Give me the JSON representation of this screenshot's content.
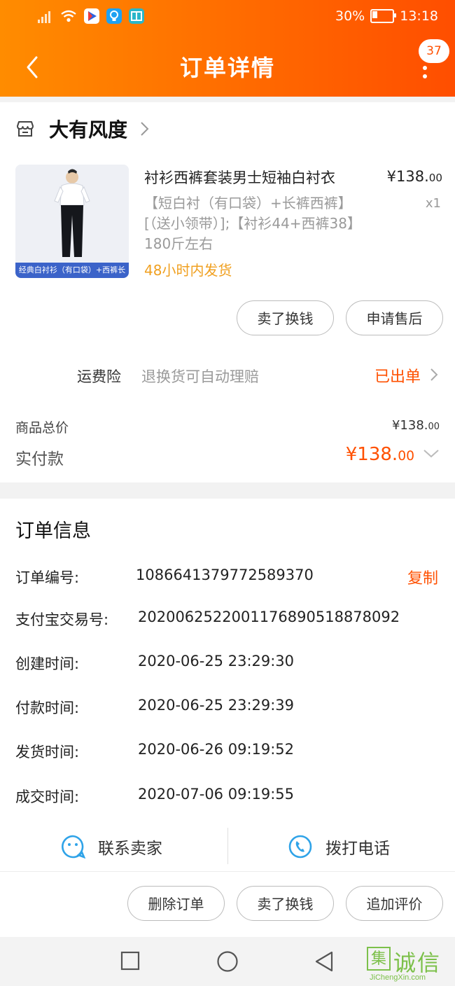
{
  "status_bar": {
    "battery": "30%",
    "battery_level": 0.3,
    "time": "13:18"
  },
  "header": {
    "title": "订单详情",
    "badge": "37"
  },
  "shop": {
    "name": "大有风度"
  },
  "product": {
    "title": "衬衫西裤套装男士短袖白衬衣",
    "price_main": "¥138.",
    "price_decimal": "00",
    "quantity": "x1",
    "spec": "【短白衬（有口袋）+长裤西裤】[（送小领带）];【衬衫44+西裤38】180斤左右",
    "shipping": "48小时内发货",
    "image_caption": "经典白衬衫（有口袋）+西裤长裤"
  },
  "product_actions": {
    "sell": "卖了换钱",
    "after_sale": "申请售后"
  },
  "insurance": {
    "label": "运费险",
    "desc": "退换货可自动理赔",
    "status": "已出单"
  },
  "price_summary": {
    "subtotal_label": "商品总价",
    "subtotal_main": "¥138.",
    "subtotal_decimal": "00",
    "paid_label": "实付款",
    "paid_main": "¥138.",
    "paid_decimal": "00"
  },
  "order_info": {
    "title": "订单信息",
    "copy": "复制",
    "rows": [
      {
        "label": "订单编号:",
        "value": "1086641379772589370"
      },
      {
        "label": "支付宝交易号:",
        "value": "2020062522001176890518878092"
      },
      {
        "label": "创建时间:",
        "value": "2020-06-25 23:29:30"
      },
      {
        "label": "付款时间:",
        "value": "2020-06-25 23:29:39"
      },
      {
        "label": "发货时间:",
        "value": "2020-06-26 09:19:52"
      },
      {
        "label": "成交时间:",
        "value": "2020-07-06 09:19:55"
      }
    ]
  },
  "contact": {
    "seller": "联系卖家",
    "call": "拨打电话"
  },
  "bottom_actions": {
    "delete": "删除订单",
    "sell": "卖了换钱",
    "review": "追加评价"
  },
  "watermark": {
    "text": "诚信",
    "box": "集",
    "url": "JiChengXin.com"
  },
  "colors": {
    "accent": "#ff5000",
    "header_start": "#ff8c00",
    "header_end": "#ff4e00",
    "shipping_note": "#f0a020",
    "contact_icon": "#2fa3e8"
  },
  "icons": [
    "back-arrow-icon",
    "more-dots-icon",
    "store-icon",
    "chevron-right-icon",
    "chevron-down-icon",
    "chat-face-icon",
    "phone-icon",
    "nav-square-icon",
    "nav-circle-icon",
    "nav-triangle-icon"
  ]
}
